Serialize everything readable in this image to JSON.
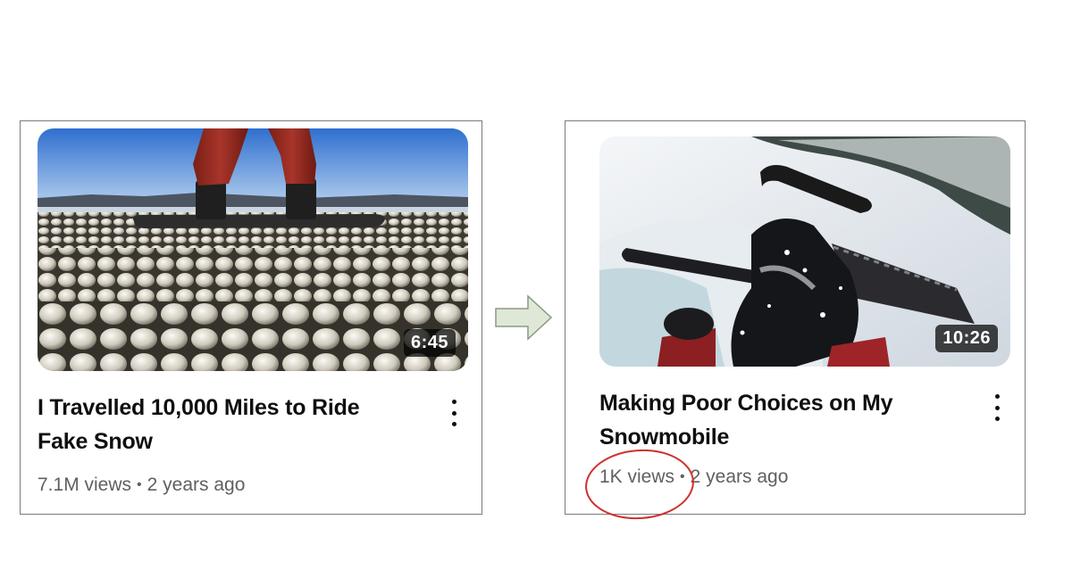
{
  "videos": [
    {
      "title": "I Travelled 10,000 Miles to Ride Fake Snow",
      "duration": "6:45",
      "views": "7.1M views",
      "separator": "•",
      "age": "2 years ago"
    },
    {
      "title": "Making Poor Choices on My Snowmobile",
      "duration": "10:26",
      "views": "1K views",
      "separator": "•",
      "age": "2 years ago"
    }
  ],
  "colors": {
    "highlight": "#d0302a",
    "arrow_fill": "#dfe8d6",
    "arrow_stroke": "#8a9a80",
    "title_text": "#0f0f0f",
    "meta_text": "#606060"
  },
  "icons": {
    "menu": "more-vert-icon",
    "transition": "right-arrow-icon"
  }
}
